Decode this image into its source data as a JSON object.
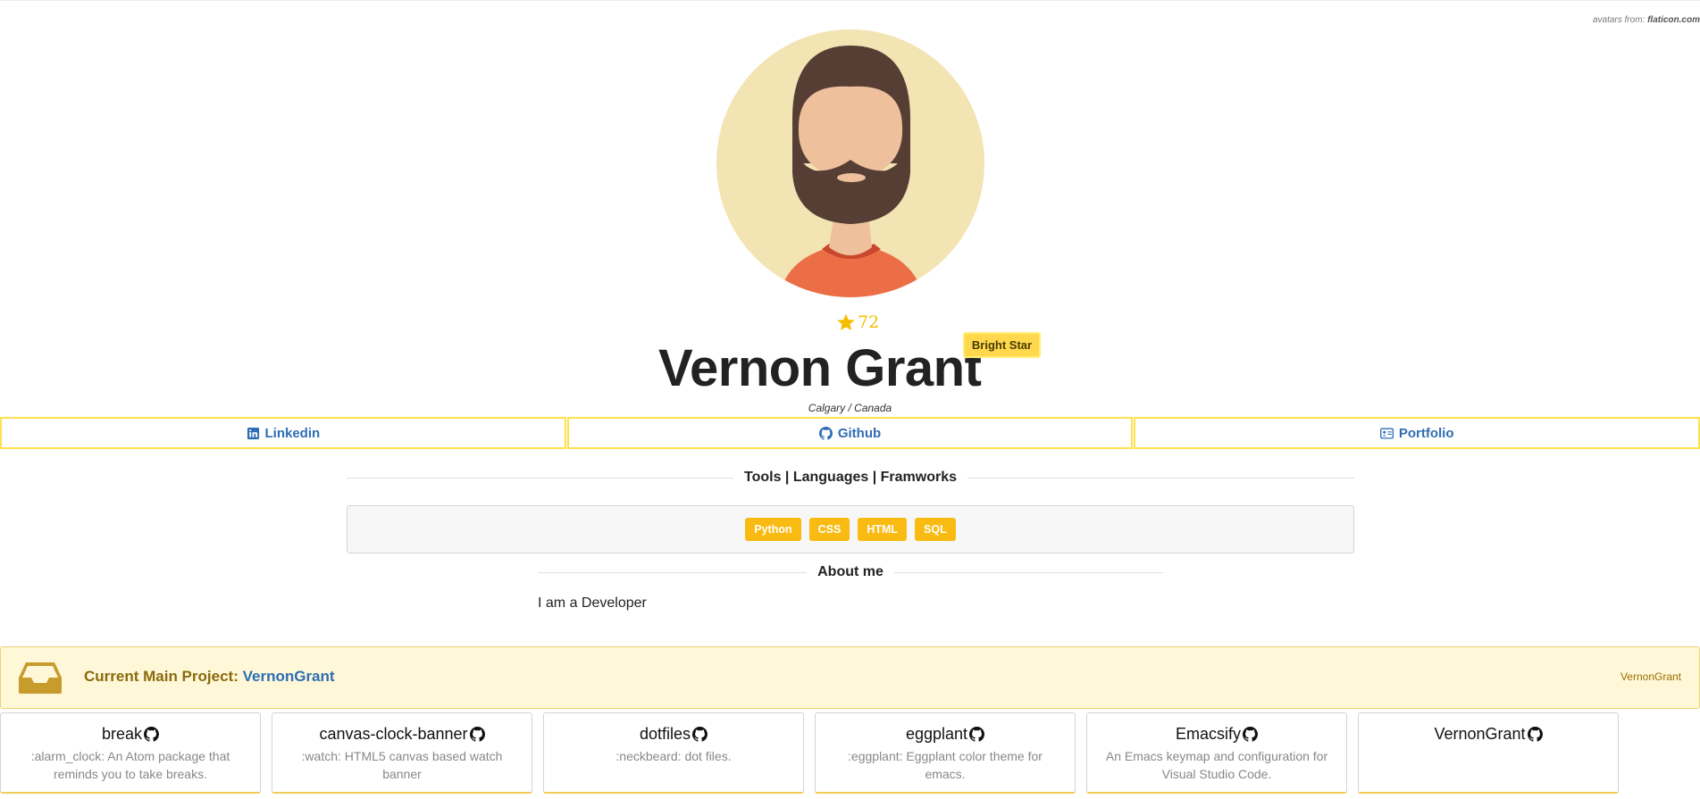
{
  "credit": {
    "prefix": "avatars from:",
    "source": "flaticon.com"
  },
  "profile": {
    "score": "72",
    "name": "Vernon Grant",
    "badge": "Bright Star",
    "location": "Calgary / Canada",
    "avatar_icon": "bearded-man-avatar"
  },
  "links": [
    {
      "label": "Linkedin",
      "icon": "linkedin-icon"
    },
    {
      "label": "Github",
      "icon": "github-icon"
    },
    {
      "label": "Portfolio",
      "icon": "id-card-icon"
    }
  ],
  "skills": {
    "heading": "Tools | Languages | Framworks",
    "tags": [
      "Python",
      "CSS",
      "HTML",
      "SQL"
    ]
  },
  "about": {
    "heading": "About me",
    "text": "I am a Developer"
  },
  "main_project": {
    "label": "Current Main Project:",
    "project": "VernonGrant",
    "right_link": "VernonGrant",
    "icon": "inbox-icon"
  },
  "repos": [
    {
      "title": "break",
      "desc": ":alarm_clock: An Atom package that reminds you to take breaks."
    },
    {
      "title": "canvas-clock-banner",
      "desc": ":watch: HTML5 canvas based watch banner"
    },
    {
      "title": "dotfiles",
      "desc": ":neckbeard: dot files."
    },
    {
      "title": "eggplant",
      "desc": ":eggplant: Eggplant color theme for emacs."
    },
    {
      "title": "Emacsify",
      "desc": "An Emacs keymap and configuration for Visual Studio Code."
    },
    {
      "title": "VernonGrant",
      "desc": ""
    }
  ],
  "colors": {
    "accent_yellow": "#f9bb12",
    "link_blue": "#2e6db4",
    "border_yellow": "#fde24f",
    "banner_bg": "#fef8d9"
  }
}
